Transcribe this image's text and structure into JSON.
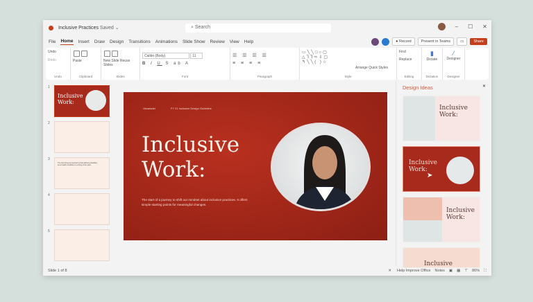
{
  "title_bar": {
    "doc_title": "Inclusive Practices",
    "save_state": "Saved ⌄",
    "search_placeholder": "Search",
    "min": "–",
    "max": "☐",
    "close": "✕"
  },
  "tabs": [
    "File",
    "Home",
    "Insert",
    "Draw",
    "Design",
    "Transitions",
    "Animations",
    "Slide Show",
    "Review",
    "View",
    "Help"
  ],
  "tab_right": {
    "record": "Record",
    "present": "Present in Teams",
    "share": "Share"
  },
  "ribbon": {
    "undo": "Undo",
    "redo": "Redo",
    "paste": "Paste",
    "new_slide": "New Slide",
    "reuse": "Reuse Slides",
    "font": "Calibri (Body)",
    "size": "11",
    "arrange": "Arrange",
    "quick_styles": "Quick Styles",
    "find": "Find",
    "replace": "Replace",
    "dictate": "Dictate",
    "designer": "Designer",
    "groups": {
      "undo": "Undo",
      "clipboard": "Clipboard",
      "slides": "Slides",
      "font": "Font",
      "paragraph": "Paragraph",
      "style": "Style",
      "editing": "Editing",
      "dictation": "Dictation",
      "designer": "Designer"
    }
  },
  "thumbnails": [
    {
      "n": "1",
      "title": "Inclusive Work:"
    },
    {
      "n": "2"
    },
    {
      "n": "3",
      "text": "The first thing we learned is that defining disability as a health condition is a thing of the past."
    },
    {
      "n": "4"
    },
    {
      "n": "5"
    }
  ],
  "slide": {
    "brand": "Vanarsdel",
    "header": "FY 21 Inclusive Design Guideline",
    "title_line1": "Inclusive",
    "title_line2": "Work:",
    "subtitle": "The start of a journey to shift our mindset about inclusive practices. It offers simple starting points for meaningful changes.",
    "bg": "#a82a1c"
  },
  "design_ideas": {
    "title": "Design Ideas",
    "close": "✕",
    "idea_title_1": "Inclusive",
    "idea_title_2": "Work:"
  },
  "status": {
    "slide": "Slide 1 of 8",
    "help": "Help Improve Office",
    "notes": "Notes",
    "zoom": "86%"
  },
  "colors": {
    "accent": "#c43e1c"
  }
}
